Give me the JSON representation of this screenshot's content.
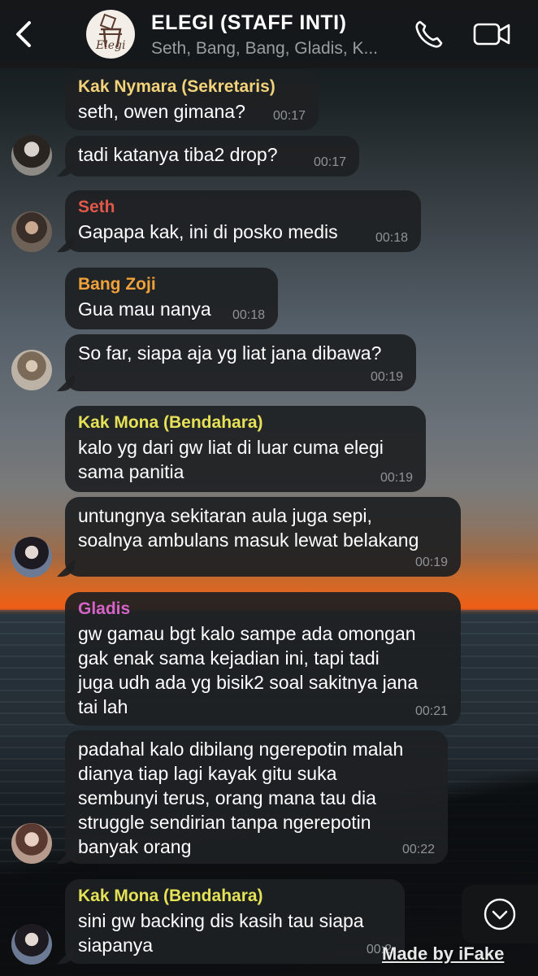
{
  "header": {
    "back_icon": "chevron-left-icon",
    "title": "ELEGI (STAFF INTI)",
    "members": "Seth, Bang, Bang, Gladis, K...",
    "group_logo_text": "Elegi",
    "call_icon": "phone-icon",
    "video_icon": "video-camera-icon"
  },
  "messages": [
    {
      "sender": "Kak Nymara (Sekretaris)",
      "sender_color": "#f2d27a",
      "text": "seth, owen gimana?",
      "time": "00:17"
    },
    {
      "sender": "",
      "text": "tadi katanya tiba2 drop?",
      "time": "00:17"
    },
    {
      "sender": "Seth",
      "sender_color": "#e0584a",
      "text": "Gapapa kak, ini di posko medis",
      "time": "00:18"
    },
    {
      "sender": "Bang Zoji",
      "sender_color": "#f0a23a",
      "text": "Gua mau nanya",
      "time": "00:18"
    },
    {
      "sender": "",
      "text": "So far, siapa aja yg liat jana dibawa?",
      "time": "00:19"
    },
    {
      "sender": "Kak Mona (Bendahara)",
      "sender_color": "#e6e257",
      "text": "kalo yg dari gw liat di luar cuma elegi\nsama panitia",
      "time": "00:19"
    },
    {
      "sender": "",
      "text": "untungnya sekitaran aula juga sepi,\nsoalnya ambulans masuk lewat belakang",
      "time": "00:19"
    },
    {
      "sender": "Gladis",
      "sender_color": "#d464c8",
      "text": "gw gamau bgt kalo sampe ada omongan\ngak enak sama kejadian ini, tapi tadi\njuga udh ada yg bisik2 soal sakitnya jana\ntai lah",
      "time": "00:21"
    },
    {
      "sender": "",
      "text": "padahal kalo dibilang ngerepotin malah\ndianya tiap lagi kayak gitu suka\nsembunyi terus, orang mana tau dia\nstruggle sendirian tanpa ngerepotin\nbanyak orang",
      "time": "00:22"
    },
    {
      "sender": "Kak Mona (Bendahara)",
      "sender_color": "#e6e257",
      "text": "sini gw backing dis kasih tau siapa\nsiapanya",
      "time": "00:2"
    }
  ],
  "scroll_down_icon": "chevron-down-circle-icon",
  "watermark": "Made by iFake"
}
